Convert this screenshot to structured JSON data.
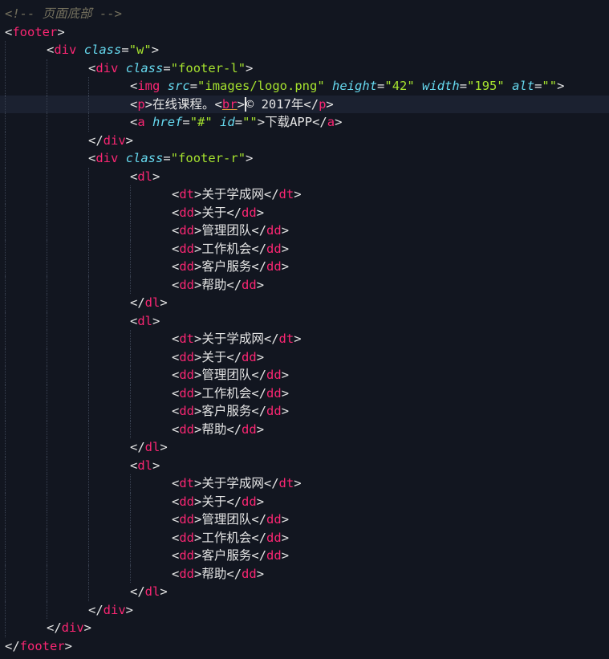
{
  "colors": {
    "background": "#121620",
    "tag": "#f92672",
    "attribute": "#66d9ef",
    "string": "#a6e22e",
    "comment": "#75715e",
    "text": "#e6e6e6"
  },
  "code": {
    "l1": {
      "comment": "<!-- 页面底部 -->"
    },
    "l2": {
      "tag": "footer"
    },
    "l3": {
      "tag": "div",
      "attr": "class",
      "val": "\"w\""
    },
    "l4": {
      "tag": "div",
      "attr": "class",
      "val": "\"footer-l\""
    },
    "l5": {
      "tag": "img",
      "a1": "src",
      "v1": "\"images/logo.png\"",
      "a2": "height",
      "v2": "\"42\"",
      "a3": "width",
      "v3": "\"195\"",
      "a4": "alt",
      "v4": "\"\""
    },
    "l6": {
      "tag": "p",
      "text1": "在线课程。",
      "br": "br",
      "text2": "© 2017年"
    },
    "l7": {
      "tag": "a",
      "a1": "href",
      "v1": "\"#\"",
      "a2": "id",
      "v2": "\"\"",
      "text": "下载APP"
    },
    "l8": {
      "tag": "div"
    },
    "l9": {
      "tag": "div",
      "attr": "class",
      "val": "\"footer-r\""
    },
    "dl_tag": "dl",
    "dt_tag": "dt",
    "dd_tag": "dd",
    "dt_text": "关于学成网",
    "dd_items": [
      "关于",
      "管理团队",
      "工作机会",
      "客户服务",
      "帮助"
    ],
    "close_div": "div",
    "close_footer": "footer"
  }
}
